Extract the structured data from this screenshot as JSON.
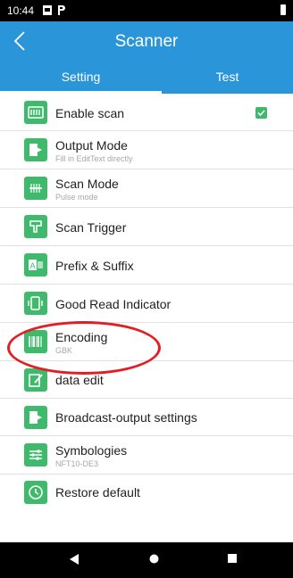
{
  "status_bar": {
    "time": "10:44"
  },
  "app_bar": {
    "title": "Scanner"
  },
  "tabs": [
    {
      "label": "Setting",
      "selected": true
    },
    {
      "label": "Test",
      "selected": false
    }
  ],
  "settings": [
    {
      "label": "Enable scan",
      "subtitle": "",
      "icon": "scan-icon",
      "checked": true
    },
    {
      "label": "Output Mode",
      "subtitle": "Fill in EditText directly",
      "icon": "output-icon"
    },
    {
      "label": "Scan Mode",
      "subtitle": "Pulse mode",
      "icon": "scan-mode-icon"
    },
    {
      "label": "Scan Trigger",
      "subtitle": "",
      "icon": "trigger-icon"
    },
    {
      "label": "Prefix & Suffix",
      "subtitle": "",
      "icon": "prefix-suffix-icon"
    },
    {
      "label": "Good Read Indicator",
      "subtitle": "",
      "icon": "indicator-icon"
    },
    {
      "label": "Encoding",
      "subtitle": "GBK",
      "icon": "barcode-icon"
    },
    {
      "label": "data edit",
      "subtitle": "",
      "icon": "edit-icon"
    },
    {
      "label": "Broadcast-output settings",
      "subtitle": "",
      "icon": "broadcast-icon"
    },
    {
      "label": "Symbologies",
      "subtitle": "NFT10-DE3",
      "icon": "sliders-icon"
    },
    {
      "label": "Restore default",
      "subtitle": "",
      "icon": "restore-icon"
    }
  ],
  "colors": {
    "accent": "#2a95d9",
    "icon_green": "#3fb96b",
    "highlight": "#e41d22"
  }
}
